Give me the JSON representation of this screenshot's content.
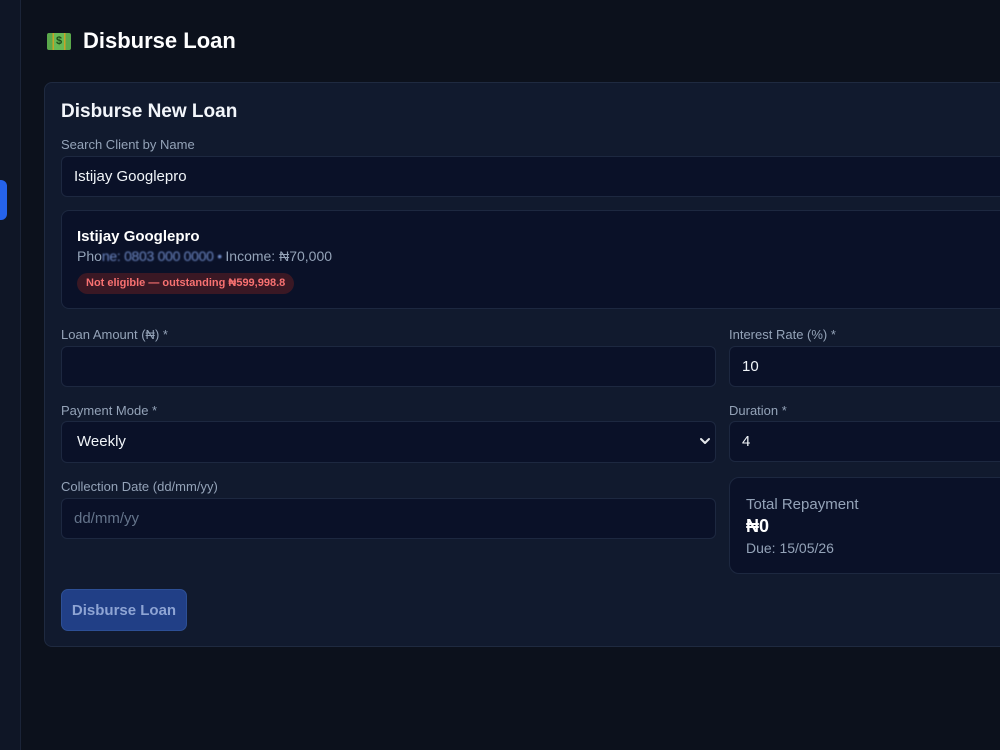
{
  "page": {
    "title": "Disburse Loan",
    "icon": "money-icon"
  },
  "form": {
    "title": "Disburse New Loan",
    "search": {
      "label": "Search Client by Name",
      "value": "Istijay Googlepro"
    },
    "client": {
      "name": "Istijay Googlepro",
      "phone_prefix": "Pho",
      "phone_obscured": "ne: 0803 000 0000 • ",
      "income": "Income: ₦70,000",
      "eligibility": "Not eligible — outstanding ₦599,998.8"
    },
    "loan_amount": {
      "label": "Loan Amount (₦) *",
      "value": ""
    },
    "interest_rate": {
      "label": "Interest Rate (%) *",
      "value": "10"
    },
    "payment_mode": {
      "label": "Payment Mode *",
      "value": "Weekly"
    },
    "duration": {
      "label": "Duration *",
      "value": "4"
    },
    "collection_date": {
      "label": "Collection Date (dd/mm/yy)",
      "placeholder": "dd/mm/yy",
      "value": ""
    },
    "summary": {
      "label": "Total Repayment",
      "amount": "₦0",
      "due": "Due: 15/05/26"
    },
    "submit_label": "Disburse Loan"
  },
  "colors": {
    "accent": "#2563eb",
    "card": "#111a2e",
    "danger": "#f87171"
  }
}
